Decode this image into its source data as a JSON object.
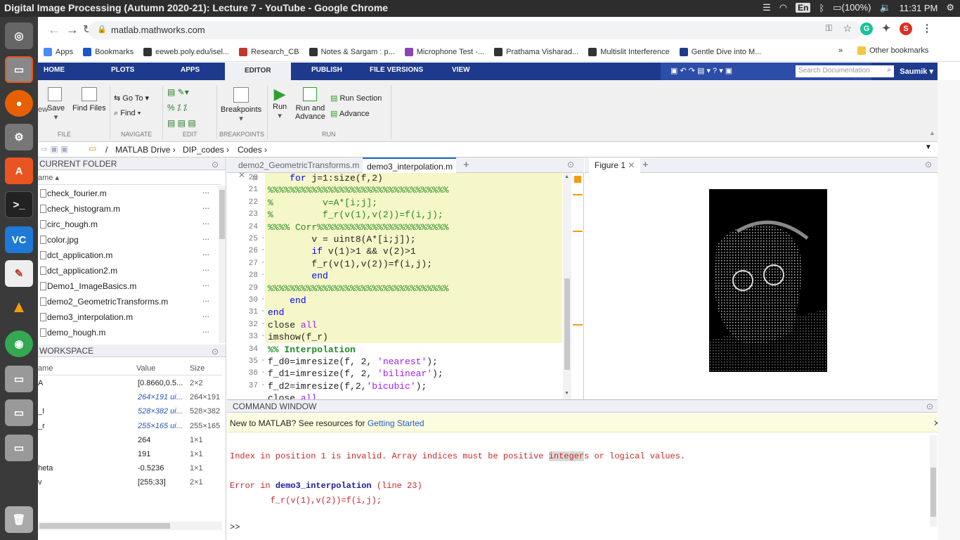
{
  "os": {
    "window_title": "Digital Image Processing (Autumn 2020-21): Lecture 7 - YouTube - Google Chrome",
    "lang": "En",
    "battery": "(100%)",
    "clock": "11:31 PM"
  },
  "browser": {
    "url": "matlab.mathworks.com",
    "bookmarks": [
      {
        "label": "Apps",
        "color": "#4a8bf5"
      },
      {
        "label": "Bookmarks",
        "color": "#1a57c9"
      },
      {
        "label": "eeweb.poly.edu/isel...",
        "color": "#333"
      },
      {
        "label": "Research_CB",
        "color": "#c0392b"
      },
      {
        "label": "Notes & Sargam : p...",
        "color": "#333"
      },
      {
        "label": "Microphone Test -...",
        "color": "#8e44ad"
      },
      {
        "label": "Prathama Visharad...",
        "color": "#333"
      },
      {
        "label": "Multislit Interference",
        "color": "#333"
      },
      {
        "label": "Gentle Dive into M...",
        "color": "#1e3a8a"
      }
    ],
    "more": "»",
    "other_bookmarks": "Other bookmarks",
    "avatar_letter": "S"
  },
  "toolstrip": {
    "tabs": [
      "HOME",
      "PLOTS",
      "APPS",
      "EDITOR",
      "PUBLISH",
      "FILE VERSIONS",
      "VIEW"
    ],
    "search_placeholder": "Search Documentation",
    "user": "Saumik",
    "ribbon": {
      "save": "Save",
      "find_files": "Find Files",
      "goto": "Go To",
      "find": "Find",
      "breakpoints": "Breakpoints",
      "run": "Run",
      "run_advance_1": "Run and",
      "run_advance_2": "Advance",
      "run_section": "Run Section",
      "advance": "Advance",
      "groups": [
        "FILE",
        "NAVIGATE",
        "EDIT",
        "BREAKPOINTS",
        "RUN"
      ]
    }
  },
  "path": {
    "drive": "MATLAB Drive",
    "folder1": "DIP_codes",
    "folder2": "Codes",
    "sep": "/"
  },
  "current_folder": {
    "title": "CURRENT FOLDER",
    "col_name": "ame",
    "files": [
      "check_fourier.m",
      "check_histogram.m",
      "circ_hough.m",
      "color.jpg",
      "dct_application.m",
      "dct_application2.m",
      "Demo1_ImageBasics.m",
      "demo2_GeometricTransforms.m",
      "demo3_interpolation.m",
      "demo_hough.m"
    ],
    "dots": "..."
  },
  "workspace": {
    "title": "WORKSPACE",
    "cols": [
      "ame",
      "Value",
      "Size"
    ],
    "rows": [
      {
        "name": "A",
        "value": "[0.8660,0.5...",
        "size": "2×2"
      },
      {
        "name": "",
        "value": "264×191 ui...",
        "size": "264×191"
      },
      {
        "name": "_I",
        "value": "528×382 ui...",
        "size": "528×382"
      },
      {
        "name": "_r",
        "value": "255×165 ui...",
        "size": "255×165"
      },
      {
        "name": "",
        "value": "264",
        "size": "1×1"
      },
      {
        "name": "",
        "value": "191",
        "size": "1×1"
      },
      {
        "name": "heta",
        "value": "-0.5236",
        "size": "1×1"
      },
      {
        "name": "v",
        "value": "[255;33]",
        "size": "2×1"
      }
    ]
  },
  "editor": {
    "tabs": [
      "demo2_GeometricTransforms.m",
      "demo3_interpolation.m"
    ],
    "lines": [
      {
        "n": "20",
        "t": "    for j=1:size(f,2)"
      },
      {
        "n": "21",
        "t": "%%%%%%%%%%%%%%%%%%%%%%%%%%%%%%%%%"
      },
      {
        "n": "22",
        "t": "%         v=A*[i;j];"
      },
      {
        "n": "23",
        "t": "%         f_r(v(1),v(2))=f(i,j);"
      },
      {
        "n": "24",
        "t": "%%%% Corr%%%%%%%%%%%%%%%%%%%%%%%%"
      },
      {
        "n": "25",
        "t": "        v = uint8(A*[i;j]);"
      },
      {
        "n": "26",
        "t": "        if v(1)>1 && v(2)>1"
      },
      {
        "n": "27",
        "t": "        f_r(v(1),v(2))=f(i,j);"
      },
      {
        "n": "28",
        "t": "        end"
      },
      {
        "n": "29",
        "t": "%%%%%%%%%%%%%%%%%%%%%%%%%%%%%%%%%"
      },
      {
        "n": "30",
        "t": "    end"
      },
      {
        "n": "31",
        "t": "end"
      },
      {
        "n": "32",
        "t": "close all"
      },
      {
        "n": "33",
        "t": "imshow(f_r)"
      },
      {
        "n": "34",
        "t": "%% Interpolation"
      },
      {
        "n": "35",
        "t": "f_d0=imresize(f, 2, 'nearest');"
      },
      {
        "n": "36",
        "t": "f_d1=imresize(f, 2, 'bilinear');"
      },
      {
        "n": "37",
        "t": "f_d2=imresize(f,2,'bicubic');"
      },
      {
        "n": "",
        "t": "close all"
      }
    ]
  },
  "figure": {
    "tab": "Figure 1"
  },
  "command_window": {
    "title": "COMMAND WINDOW",
    "banner_text": "New to MATLAB? See resources for ",
    "banner_link": "Getting Started",
    "error_line1": "Index in position 1 is invalid. Array indices must be positive integers or logical values.",
    "error_in": "Error in ",
    "error_func": "demo3_interpolation",
    "error_where": " (line 23)",
    "error_code": "        f_r(v(1),v(2))=f(i,j);",
    "prompt": ">>"
  }
}
